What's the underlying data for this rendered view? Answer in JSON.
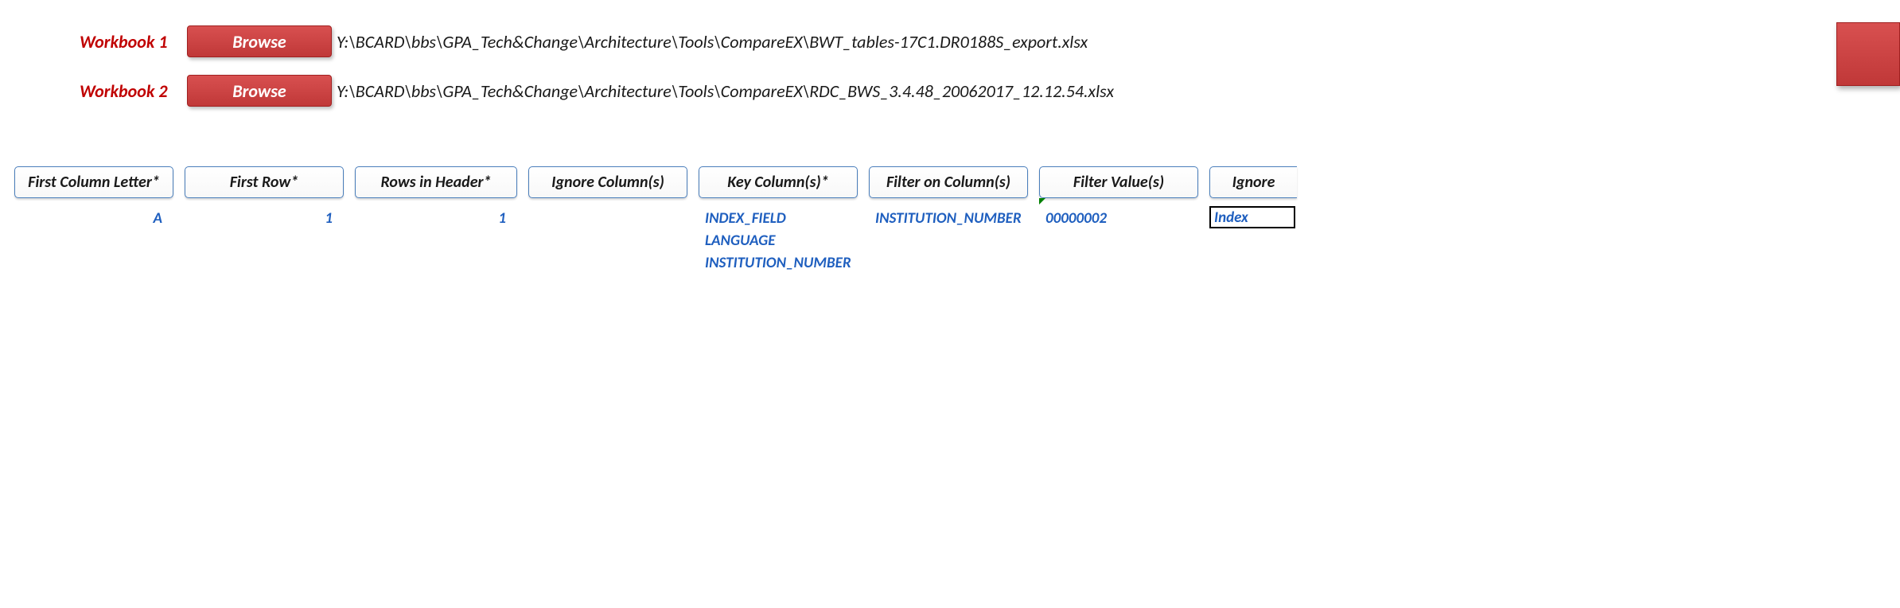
{
  "workbooks": [
    {
      "label": "Workbook 1",
      "button": "Browse",
      "path": "Y:\\BCARD\\bbs\\GPA_Tech&Change\\Architecture\\Tools\\CompareEX\\BWT_tables-17C1.DR0188S_export.xlsx"
    },
    {
      "label": "Workbook 2",
      "button": "Browse",
      "path": "Y:\\BCARD\\bbs\\GPA_Tech&Change\\Architecture\\Tools\\CompareEX\\RDC_BWS_3.4.48_20062017_12.12.54.xlsx"
    }
  ],
  "columns": {
    "first_col_letter": {
      "header": "First Column Letter*",
      "value": "A"
    },
    "first_row": {
      "header": "First Row*",
      "value": "1"
    },
    "rows_in_header": {
      "header": "Rows in Header*",
      "value": "1"
    },
    "ignore_columns": {
      "header": "Ignore Column(s)",
      "value": ""
    },
    "key_columns": {
      "header": "Key Column(s)*",
      "values": [
        "INDEX_FIELD",
        "LANGUAGE",
        "INSTITUTION_NUMBER"
      ]
    },
    "filter_on_columns": {
      "header": "Filter on Column(s)",
      "value": "INSTITUTION_NUMBER"
    },
    "filter_values": {
      "header": "Filter Value(s)",
      "value": "00000002"
    },
    "ignore2": {
      "header": "Ignore",
      "value": "Index"
    }
  }
}
